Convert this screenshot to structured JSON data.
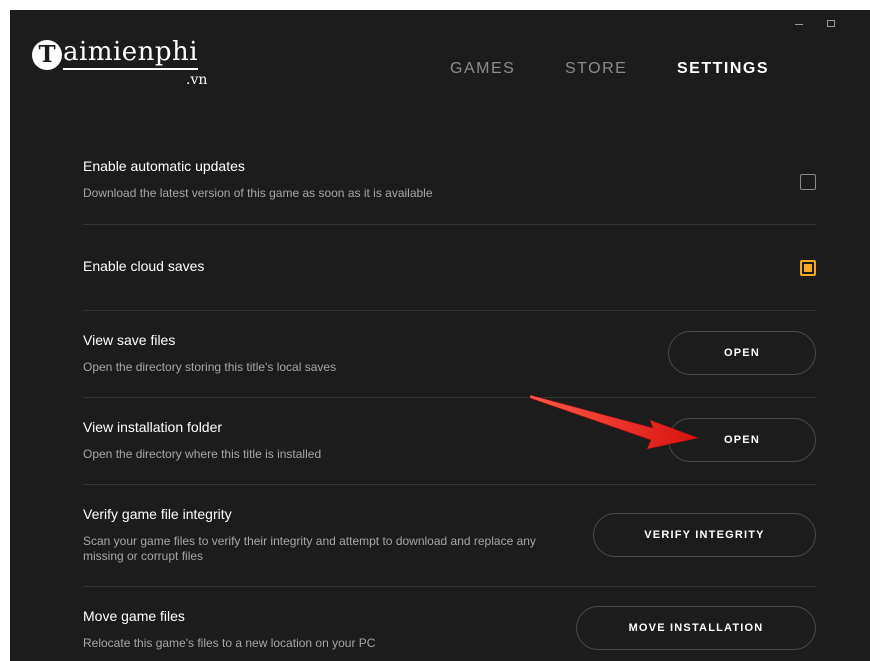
{
  "logo": {
    "initial": "T",
    "text": "aimienphi",
    "sub": ".vn"
  },
  "nav": {
    "games": "GAMES",
    "store": "STORE",
    "settings": "SETTINGS"
  },
  "settings": [
    {
      "title": "Enable automatic updates",
      "desc": "Download the latest version of this game as soon as it is available",
      "control": "checkbox",
      "checked": false
    },
    {
      "title": "Enable cloud saves",
      "desc": "",
      "control": "checkbox",
      "checked": true
    },
    {
      "title": "View save files",
      "desc": "Open the directory storing this title's local saves",
      "control": "button",
      "button_label": "OPEN"
    },
    {
      "title": "View installation folder",
      "desc": "Open the directory where this title is installed",
      "control": "button",
      "button_label": "OPEN"
    },
    {
      "title": "Verify game file integrity",
      "desc": "Scan your game files to verify their integrity and attempt to download and replace any missing or corrupt files",
      "control": "button",
      "button_label": "VERIFY INTEGRITY"
    },
    {
      "title": "Move game files",
      "desc": "Relocate this game's files to a new location on your PC",
      "control": "button",
      "button_label": "MOVE INSTALLATION"
    }
  ],
  "colors": {
    "background": "#1c1c1c",
    "accent": "#f5a623",
    "annotation_arrow": "#e8201c"
  },
  "icons": {
    "annotation": "red-arrow-icon",
    "minimize": "minimize-icon",
    "maximize": "maximize-icon"
  }
}
